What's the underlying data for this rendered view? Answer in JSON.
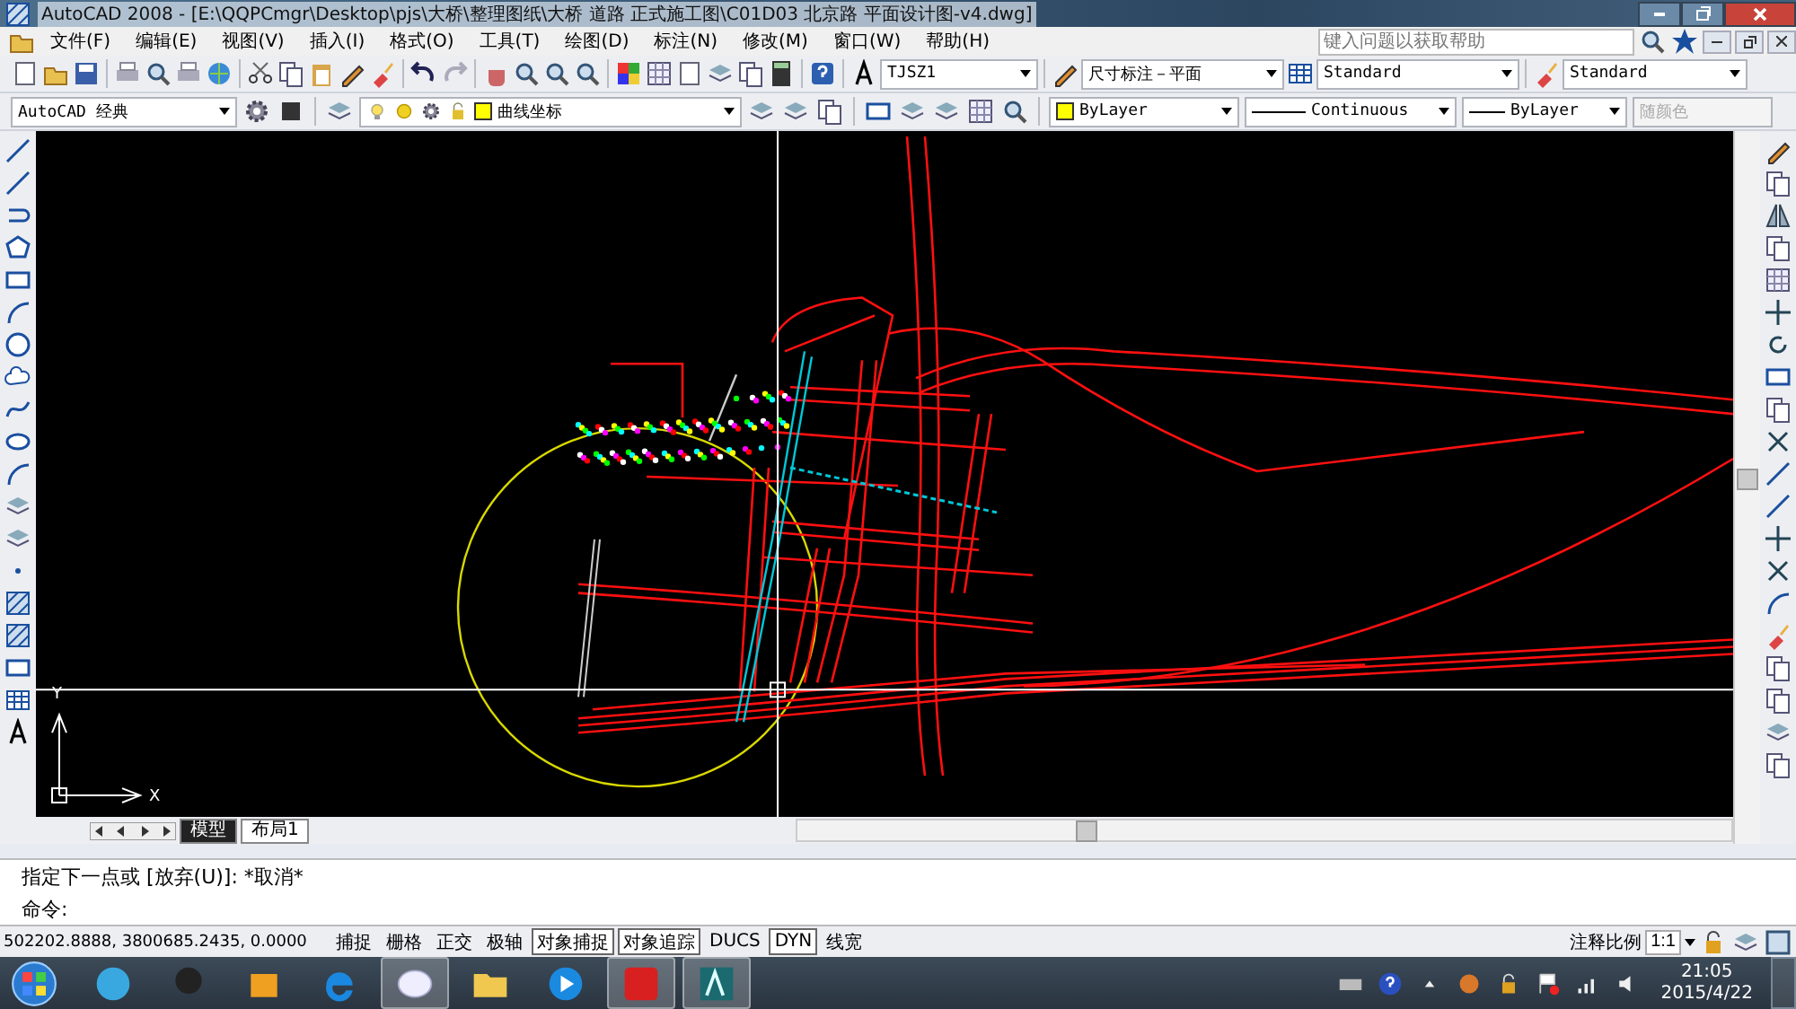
{
  "window": {
    "title": "AutoCAD 2008 - [E:\\QQPCmgr\\Desktop\\pjs\\大桥\\整理图纸\\大桥 道路 正式施工图\\C01D03 北京路 平面设计图-v4.dwg]"
  },
  "menu": [
    "文件(F)",
    "编辑(E)",
    "视图(V)",
    "插入(I)",
    "格式(O)",
    "工具(T)",
    "绘图(D)",
    "标注(N)",
    "修改(M)",
    "窗口(W)",
    "帮助(H)"
  ],
  "help_search": {
    "placeholder": "键入问题以获取帮助"
  },
  "styles_toolbar": {
    "text_style": "TJSZ1",
    "dim_style": "尺寸标注－平面",
    "table_style": "Standard",
    "multileader_style": "Standard"
  },
  "workspace": "AutoCAD 经典",
  "layer": "曲线坐标",
  "properties_toolbar": {
    "color_control": "ByLayer",
    "linetype": "Continuous",
    "lineweight": "ByLayer",
    "plot_style": "随颜色"
  },
  "ucs": {
    "y_label": "Y",
    "x_label": "X"
  },
  "layout_tabs": [
    {
      "label": "模型",
      "selected": true
    },
    {
      "label": "布局1",
      "selected": false
    }
  ],
  "command_history": [
    "指定下一点或 [放弃(U)]: *取消*"
  ],
  "command_prompt": "命令:",
  "status_bar": {
    "coordinates": "502202.8888, 3800685.2435, 0.0000",
    "toggles": [
      {
        "label": "捕捉",
        "on": false
      },
      {
        "label": "栅格",
        "on": false
      },
      {
        "label": "正交",
        "on": false
      },
      {
        "label": "极轴",
        "on": false
      },
      {
        "label": "对象捕捉",
        "on": true
      },
      {
        "label": "对象追踪",
        "on": true
      },
      {
        "label": "DUCS",
        "on": false
      },
      {
        "label": "DYN",
        "on": true
      },
      {
        "label": "线宽",
        "on": false
      }
    ],
    "annotation_scale_label": "注释比例",
    "annotation_scale": "1:1"
  },
  "taskbar": {
    "apps": [
      {
        "open": false
      },
      {
        "open": false
      },
      {
        "open": false
      },
      {
        "open": false
      },
      {
        "open": true
      },
      {
        "open": false
      },
      {
        "open": false
      },
      {
        "open": true
      },
      {
        "open": true
      }
    ],
    "time": "21:05",
    "date": "2015/4/22"
  }
}
